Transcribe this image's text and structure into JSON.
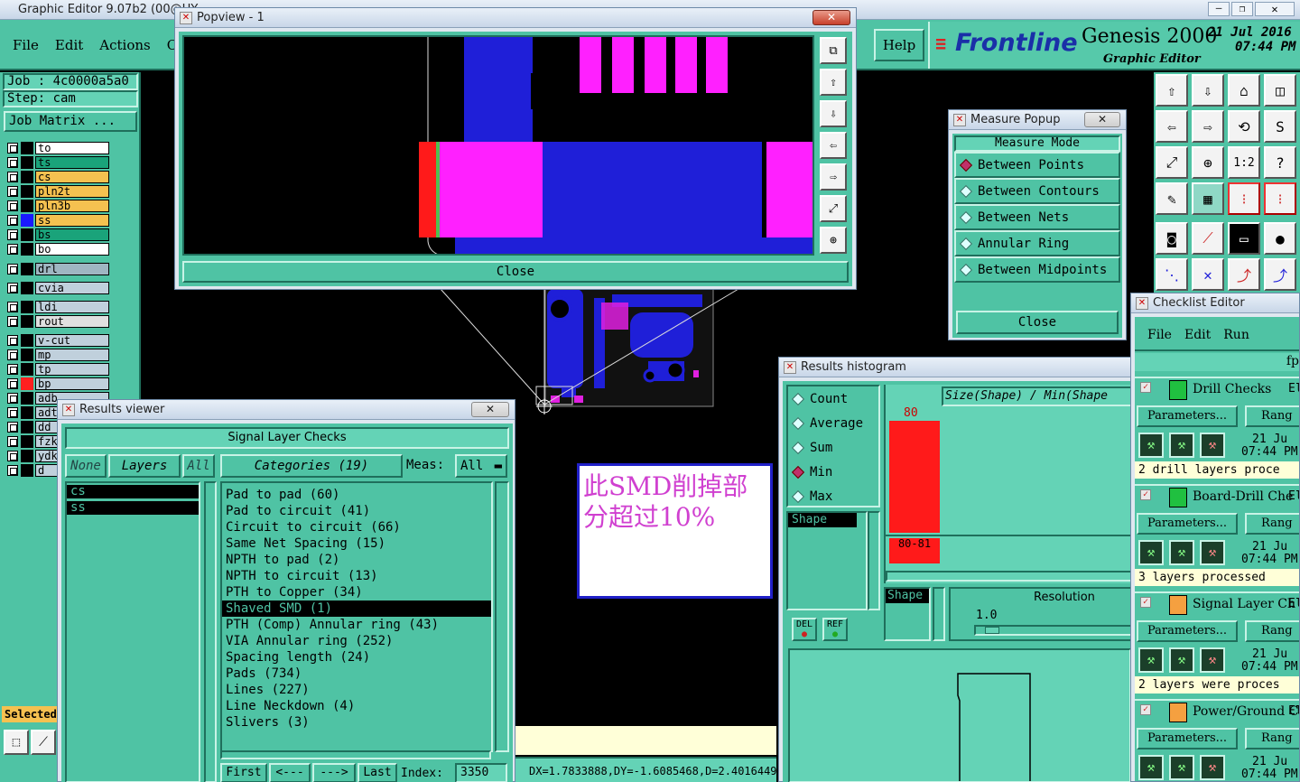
{
  "app": {
    "title": "Graphic Editor 9.07b2 (00@HY",
    "menu": [
      "File",
      "Edit",
      "Actions",
      "Opti"
    ],
    "help": "Help",
    "brand": "Frontline",
    "product": "Genesis 2000",
    "subtitle": "Graphic Editor",
    "date": "21 Jul 2016",
    "time": "07:44 PM"
  },
  "left": {
    "job": "Job : 4c0000a5a0",
    "step": "Step: cam",
    "job_matrix": "Job Matrix ...",
    "layers": [
      {
        "name": "to",
        "bg": "#ffffff",
        "sw": "#000000"
      },
      {
        "name": "ts",
        "bg": "#1aa37a",
        "sw": "#000000"
      },
      {
        "name": "cs",
        "bg": "#f5c150",
        "sw": "#000000"
      },
      {
        "name": "pln2t",
        "bg": "#f5c150",
        "sw": "#000000"
      },
      {
        "name": "pln3b",
        "bg": "#f5c150",
        "sw": "#000000"
      },
      {
        "name": "ss",
        "bg": "#f5c150",
        "sw": "#1a1aff"
      },
      {
        "name": "bs",
        "bg": "#1aa37a",
        "sw": "#000000"
      },
      {
        "name": "bo",
        "bg": "#ffffff",
        "sw": "#000000"
      },
      {
        "name": "drl",
        "bg": "#9fb6c2",
        "sw": "#000000"
      },
      {
        "name": "cvia",
        "bg": "#c0d0dc",
        "sw": "#000000"
      },
      {
        "name": "ldi",
        "bg": "#c0d0dc",
        "sw": "#000000"
      },
      {
        "name": "rout",
        "bg": "#e0e0e0",
        "sw": "#000000"
      },
      {
        "name": "v-cut",
        "bg": "#c0d0dc",
        "sw": "#000000"
      },
      {
        "name": "mp",
        "bg": "#c0d0dc",
        "sw": "#000000"
      },
      {
        "name": "tp",
        "bg": "#c0d0dc",
        "sw": "#000000"
      },
      {
        "name": "bp",
        "bg": "#c0d0dc",
        "sw": "#ff2020"
      },
      {
        "name": "adb",
        "bg": "#c0d0dc",
        "sw": "#000000"
      },
      {
        "name": "adt",
        "bg": "#c0d0dc",
        "sw": "#000000"
      },
      {
        "name": "dd",
        "bg": "#c0d0dc",
        "sw": "#000000"
      },
      {
        "name": "fzk",
        "bg": "#c0d0dc",
        "sw": "#000000"
      },
      {
        "name": "ydk",
        "bg": "#c0d0dc",
        "sw": "#000000"
      },
      {
        "name": "d",
        "bg": "#c0d0dc",
        "sw": "#000000"
      }
    ],
    "selected": "Selected"
  },
  "popview": {
    "title": "Popview - 1",
    "close": "Close",
    "close_x": "✕"
  },
  "measure": {
    "title": "Measure Popup",
    "heading": "Measure Mode",
    "modes": [
      "Between Points",
      "Between Contours",
      "Between Nets",
      "Annular Ring",
      "Between Midpoints"
    ],
    "close": "Close"
  },
  "results": {
    "title": "Results viewer",
    "heading": "Signal Layer Checks",
    "none": "None",
    "layers": "Layers",
    "all": "All",
    "categories": "Categories (19)",
    "meas": "Meas:",
    "meas_value": "All",
    "layer_items": [
      "cs",
      "ss"
    ],
    "items": [
      "Pad to pad (60)",
      "Pad to circuit (41)",
      "Circuit to circuit (66)",
      "Same Net Spacing (15)",
      "NPTH to pad (2)",
      "NPTH to circuit (13)",
      "PTH to Copper (34)",
      "Shaved SMD (1)",
      "PTH (Comp) Annular ring (43)",
      "VIA Annular ring (252)",
      "Spacing length (24)",
      "Pads (734)",
      "Lines (227)",
      "Line Neckdown (4)",
      "Slivers (3)"
    ],
    "first": "First",
    "prev": "<---",
    "next": "--->",
    "last": "Last",
    "index_label": "Index:",
    "index_value": "3350"
  },
  "annotation": "此SMD削掉部分超过10%",
  "status": "DX=1.7833888,DY=-1.6085468,D=2.4016449",
  "histogram": {
    "title": "Results histogram",
    "modes": [
      "Count",
      "Average",
      "Sum",
      "Min",
      "Max"
    ],
    "selected": "Min",
    "shape": "Shape",
    "header": "Size(Shape) / Min(Shape",
    "bar_label": "80",
    "bar_bin": "80-81",
    "resolution_label": "Resolution",
    "resolution": "1.0",
    "del": "DEL",
    "ref": "REF"
  },
  "checklist": {
    "title": "Checklist Editor",
    "menu": [
      "File",
      "Edit",
      "Run"
    ],
    "fp": "fp",
    "checks": [
      {
        "name": "Drill Checks",
        "status": "2 drill layers proce"
      },
      {
        "name": "Board-Drill Che",
        "status": "3 layers processed"
      },
      {
        "name": "Signal Layer Ch",
        "status": "2 layers were proces"
      },
      {
        "name": "Power/Ground C",
        "status": ""
      }
    ],
    "params": "Parameters...",
    "rang": "Rang",
    "date": "21 Ju",
    "time": "07:44 PM",
    "el": "El"
  }
}
